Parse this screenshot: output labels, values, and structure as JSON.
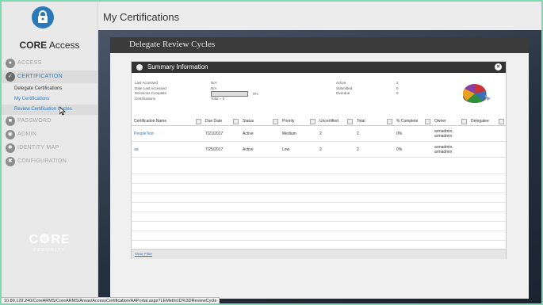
{
  "app": {
    "brand_bold": "CORE",
    "brand_light": " Access",
    "page_title": "My Certifications",
    "footer_logo": "C⚙RE",
    "footer_logo_sub": "SECURITY"
  },
  "nav": {
    "access": "ACCESS",
    "certification": "CERTIFICATION",
    "sub_delegate": "Delegate Certifications",
    "sub_my": "My Certifications",
    "sub_review": "Review Certification Cycles",
    "password": "PASSWORD",
    "admin": "ADMIN",
    "identity_map": "IDENTITY MAP",
    "configuration": "CONFIGURATION"
  },
  "panel": {
    "title": "Delegate Review Cycles",
    "summary_title": "Summary Information",
    "close": "×",
    "last_accessed_label": "Last Accessed",
    "last_accessed_value": "N/A",
    "date_last_accessed_label": "Date Last Accessed",
    "date_last_accessed_value": "N/A",
    "decisions_complete_label": "Decisions Complete",
    "decisions_complete_pct": "0%",
    "decisions_complete_fraction": 0,
    "certifications_label": "Certifications",
    "certifications_value": "Total = 2",
    "active_label": "Active",
    "active_value": "2",
    "submitted_label": "Submitted",
    "submitted_value": "0",
    "overdue_label": "Overdue",
    "overdue_value": "0",
    "clear_filter": "Clear Filter"
  },
  "table": {
    "headers": [
      "Certification Name",
      "Due Date",
      "Status",
      "Priority",
      "Uncertified",
      "Total",
      "% Complete",
      "Owner",
      "Delegatee"
    ],
    "rows": [
      [
        "PeopleTest",
        "7/21/2017",
        "Active",
        "Medium",
        "2",
        "2",
        "0%",
        "armadmin, armadmin",
        ""
      ],
      [
        "aa",
        "7/25/2017",
        "Active",
        "Low",
        "2",
        "2",
        "0%",
        "armadmin, armadmin",
        ""
      ]
    ]
  },
  "statusbar": {
    "url": "10.80.129.240/CoreARMS/CoreARMS/Areas/AccessCertification/AAPortal.aspx?LEMetricID%3DReviewCycle"
  },
  "colors": {
    "accent": "#2b7ac2",
    "frame": "#7fd9b0",
    "header_dark": "#333333"
  }
}
